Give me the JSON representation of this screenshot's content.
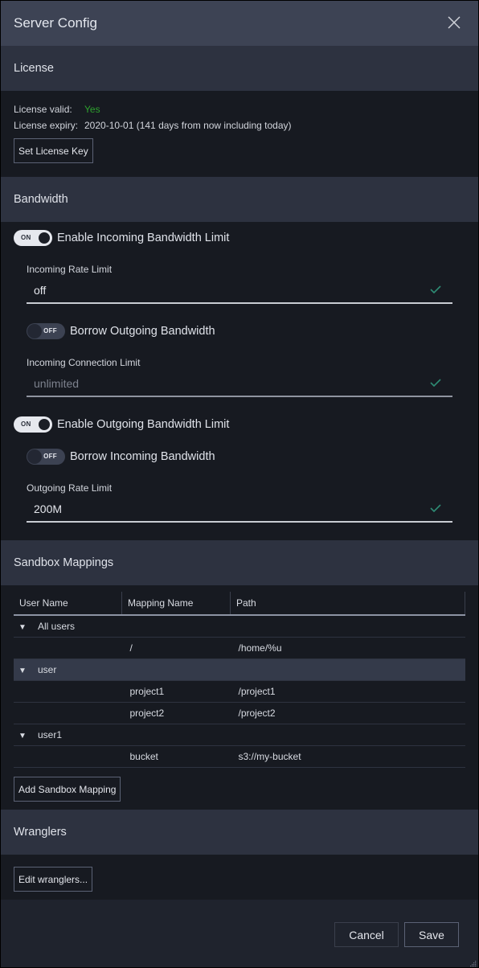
{
  "dialog": {
    "title": "Server Config",
    "close_icon": "close-icon"
  },
  "license": {
    "header": "License",
    "valid_label": "License valid:",
    "valid_value": "Yes",
    "valid_color": "#2ea12e",
    "expiry_label": "License expiry:",
    "expiry_value": "2020-10-01 (141 days from now including today)",
    "set_key_button": "Set License Key"
  },
  "bandwidth": {
    "header": "Bandwidth",
    "incoming_toggle": {
      "label": "Enable Incoming Bandwidth Limit",
      "state": "ON"
    },
    "incoming_rate": {
      "label": "Incoming Rate Limit",
      "value": "off",
      "icon": "check-icon"
    },
    "borrow_outgoing": {
      "label": "Borrow Outgoing Bandwidth",
      "state": "OFF"
    },
    "incoming_conn": {
      "label": "Incoming Connection Limit",
      "value": "",
      "placeholder": "unlimited",
      "icon": "check-icon"
    },
    "outgoing_toggle": {
      "label": "Enable Outgoing Bandwidth Limit",
      "state": "ON"
    },
    "borrow_incoming": {
      "label": "Borrow Incoming Bandwidth",
      "state": "OFF"
    },
    "outgoing_rate": {
      "label": "Outgoing Rate Limit",
      "value": "200M",
      "icon": "check-icon"
    },
    "check_color": "#2e8b74"
  },
  "sandbox": {
    "header": "Sandbox Mappings",
    "columns": [
      "User Name",
      "Mapping Name",
      "Path"
    ],
    "groups": [
      {
        "user": "All users",
        "mappings": [
          {
            "name": "/",
            "path": "/home/%u"
          }
        ]
      },
      {
        "user": "user",
        "selected": true,
        "mappings": [
          {
            "name": "project1",
            "path": "/project1"
          },
          {
            "name": "project2",
            "path": "/project2"
          }
        ]
      },
      {
        "user": "user1",
        "mappings": [
          {
            "name": "bucket",
            "path": "s3://my-bucket"
          }
        ]
      }
    ],
    "expand_glyph": "▼",
    "add_button": "Add Sandbox Mapping"
  },
  "wranglers": {
    "header": "Wranglers",
    "edit_button": "Edit wranglers..."
  },
  "footer": {
    "cancel": "Cancel",
    "save": "Save"
  }
}
